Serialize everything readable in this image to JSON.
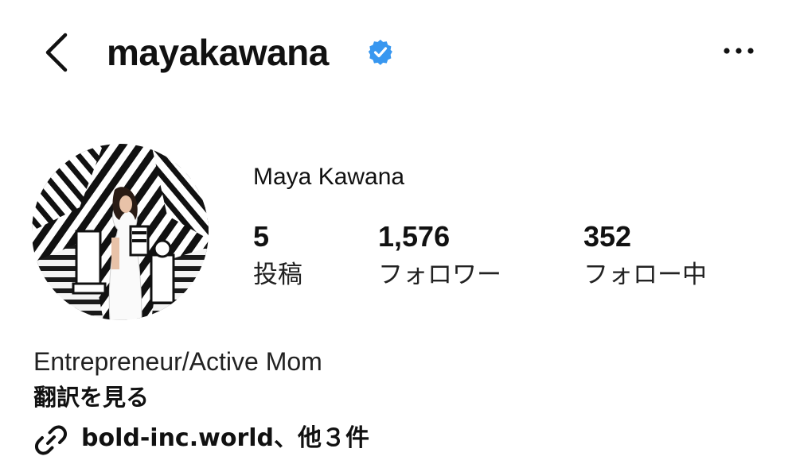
{
  "header": {
    "back_icon": "chevron-left-icon",
    "username": "mayakawana",
    "verified_icon": "verified-badge-icon",
    "more_icon": "more-horizontal-icon"
  },
  "profile": {
    "display_name": "Maya Kawana",
    "avatar": "profile-photo"
  },
  "stats": [
    {
      "value": "5",
      "label": "投稿"
    },
    {
      "value": "1,576",
      "label": "フォロワー"
    },
    {
      "value": "352",
      "label": "フォロー中"
    }
  ],
  "bio": {
    "text": "Entrepreneur/Active Mom",
    "translate_label": "翻訳を見る",
    "link_icon": "link-icon",
    "link_text": "bold-inc.world、他３件"
  },
  "colors": {
    "text": "#111111",
    "verified_blue": "#3897f0",
    "background": "#ffffff"
  }
}
